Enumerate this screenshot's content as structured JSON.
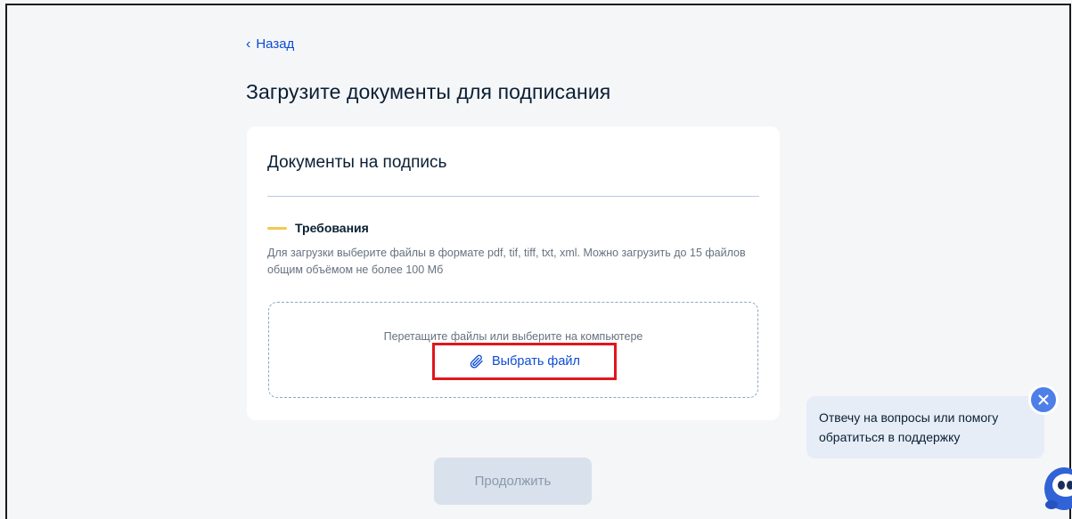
{
  "nav": {
    "back_label": "Назад"
  },
  "page": {
    "title": "Загрузите документы для подписания"
  },
  "card": {
    "title": "Документы на подпись",
    "requirements_label": "Требования",
    "requirements_text": "Для загрузки выберите файлы в формате pdf, tif, tiff, txt, xml. Можно загрузить до 15 файлов общим объёмом не более 100 Мб",
    "dropzone_hint": "Перетащите файлы или выберите на компьютере",
    "choose_file_label": "Выбрать файл"
  },
  "actions": {
    "continue_label": "Продолжить"
  },
  "chat": {
    "message": "Отвечу на вопросы или помогу обратиться в поддержку"
  },
  "icons": {
    "back": "chevron-left-icon",
    "attach": "paperclip-icon",
    "close": "close-icon",
    "assistant": "robot-mascot-icon"
  },
  "colors": {
    "link": "#0d4cd3",
    "accent_yellow": "#f2c94c",
    "highlight_red": "#e0161e",
    "disabled_button_bg": "#d8e1ec",
    "chat_bg": "#e6edf7",
    "close_bg": "#4e7fe8"
  }
}
